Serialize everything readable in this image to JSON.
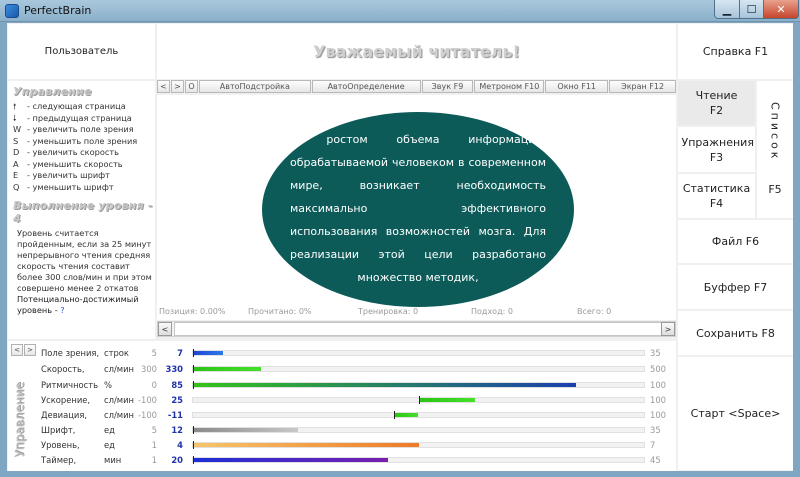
{
  "window": {
    "title": "PerfectBrain"
  },
  "user": {
    "label": "Пользователь"
  },
  "banner": {
    "text": "Уважаемый читатель!"
  },
  "controls": {
    "title": "Управление",
    "items": [
      {
        "key": "🠕",
        "label": "- следующая страница"
      },
      {
        "key": "🠗",
        "label": "- предыдущая страница"
      },
      {
        "key": "W",
        "label": "- увеличить поле зрения"
      },
      {
        "key": "S",
        "label": "- уменьшить поле зрения"
      },
      {
        "key": "D",
        "label": "- увеличить скорость"
      },
      {
        "key": "A",
        "label": "- уменьшить скорость"
      },
      {
        "key": "E",
        "label": "- увеличить шрифт"
      },
      {
        "key": "Q",
        "label": "- уменьшить шрифт"
      }
    ]
  },
  "level": {
    "title": "Выполнение уровня - 4",
    "description": "Уровень считается пройденным, если за 25 минут непрерывного чтения средняя скорость чтения составит более 300 слов/мин и при этом совершено менее 2 откатов",
    "recommended": "Потенциально-достижимый уровень -",
    "recommended_value": "?"
  },
  "toolbar": {
    "items": [
      "<",
      ">",
      "O",
      "АвтоПодстройка",
      "АвтоОпределение",
      "Звук F9",
      "Метроном F10",
      "Окно F11",
      "Экран F12"
    ]
  },
  "reading": {
    "text": "С ростом объема информации, обрабатываемой человеком в современном мире, возникает необходимость максимально эффективного использования возможностей мозга. Для реализации этой цели разработано множество методик,"
  },
  "stats": {
    "position": "Позиция: 0.00%",
    "read": "Прочитано: 0%",
    "training": "Тренировка: 0",
    "approach": "Подход: 0",
    "total": "Всего: 0"
  },
  "scroll": {
    "left": "<",
    "right": ">"
  },
  "right": {
    "help": "Справка F1",
    "read": "Чтение F2",
    "exercises": "Упражнения F3",
    "statistics": "Статистика F4",
    "list_label": "Список",
    "list_key": "F5",
    "file": "Файл F6",
    "buffer": "Буффер F7",
    "save": "Сохранить F8",
    "start": "Старт <Space>"
  },
  "management": {
    "label": "Управление",
    "left": "<",
    "right": ">",
    "params": [
      {
        "name": "Поле зрения,",
        "unit": "строк",
        "min": "5",
        "value": "7",
        "max": "35",
        "fill_from": 0.0,
        "fill_to": 0.0667,
        "colors": [
          "#1f44d8",
          "#2a78e8"
        ]
      },
      {
        "name": "Скорость,",
        "unit": "сл/мин",
        "min": "300",
        "value": "330",
        "max": "500",
        "fill_from": 0.0,
        "fill_to": 0.15,
        "colors": [
          "#2cc414",
          "#44e02a"
        ]
      },
      {
        "name": "Ритмичность",
        "unit": "%",
        "min": "0",
        "value": "85",
        "max": "100",
        "fill_from": 0.0,
        "fill_to": 0.85,
        "colors": [
          "#34c418",
          "#1b3fb0"
        ]
      },
      {
        "name": "Ускорение,",
        "unit": "сл/мин",
        "min": "-100",
        "value": "25",
        "max": "100",
        "fill_from": 0.5,
        "fill_to": 0.625,
        "colors": [
          "#2cc414",
          "#44e02a"
        ]
      },
      {
        "name": "Девиация,",
        "unit": "сл/мин",
        "min": "-100",
        "value": "-11",
        "max": "100",
        "fill_from": 0.445,
        "fill_to": 0.5,
        "colors": [
          "#2cc414",
          "#44e02a"
        ]
      },
      {
        "name": "Шрифт,",
        "unit": "ед",
        "min": "5",
        "value": "12",
        "max": "35",
        "fill_from": 0.0,
        "fill_to": 0.2333,
        "colors": [
          "#8a8a8a",
          "#c8c8c8"
        ]
      },
      {
        "name": "Уровень,",
        "unit": "ед",
        "min": "1",
        "value": "4",
        "max": "7",
        "fill_from": 0.0,
        "fill_to": 0.5,
        "colors": [
          "#f6c66a",
          "#f07a26"
        ]
      },
      {
        "name": "Таймер,",
        "unit": "мин",
        "min": "1",
        "value": "20",
        "max": "45",
        "fill_from": 0.0,
        "fill_to": 0.4318,
        "colors": [
          "#1c2fd8",
          "#7a1fb0"
        ]
      }
    ]
  },
  "colors": {
    "oval": "#0c5b59",
    "value_text": "#2233aa"
  }
}
